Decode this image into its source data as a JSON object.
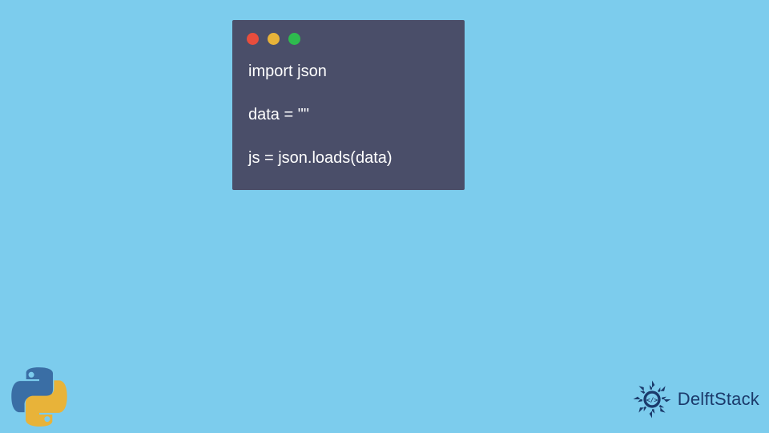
{
  "code": {
    "lines": [
      "import json",
      "",
      "data = \"\"",
      "",
      "js = json.loads(data)"
    ]
  },
  "window": {
    "dots": [
      "red",
      "yellow",
      "green"
    ]
  },
  "brand": {
    "name": "DelftStack"
  },
  "colors": {
    "background": "#7CCCED",
    "window_bg": "#4A4E69",
    "code_text": "#FFFFFF",
    "brand_text": "#1B3A6B"
  }
}
